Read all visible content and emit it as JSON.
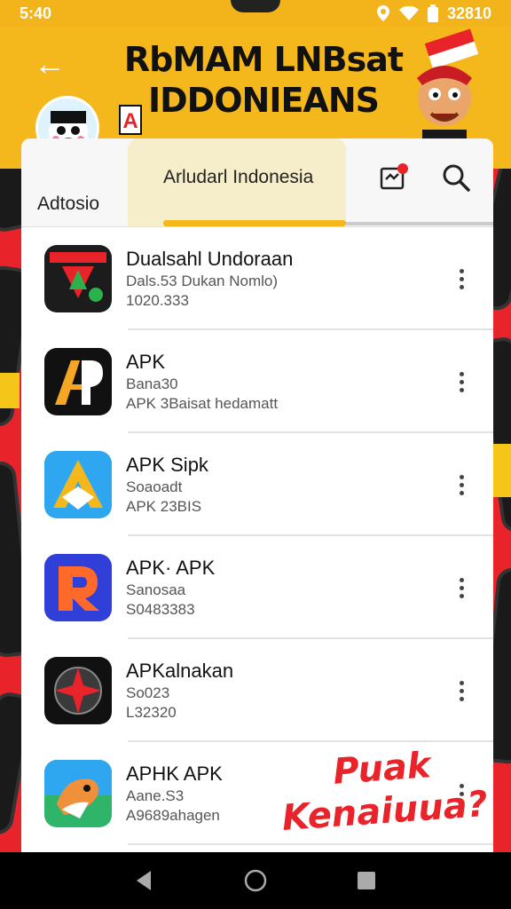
{
  "status_bar": {
    "time": "5:40",
    "battery": "32810"
  },
  "header": {
    "title_line1": "RbMAM LNBsat",
    "title_line2": "IDDONIEANS",
    "badge": "A"
  },
  "tabs": {
    "left_label": "Adtosio",
    "active_label": "Arludarl Indonesia"
  },
  "apps": [
    {
      "name": "Dualsahl Undoraan",
      "line1": "Dals.53 Dukan Nomlo)",
      "line2": "1020.333",
      "icon": "game-app-icon"
    },
    {
      "name": "APK",
      "line1": "Bana30",
      "line2": "APK 3Baisat hedamatt",
      "icon": "ap-logo-icon"
    },
    {
      "name": "APK Sipk",
      "line1": "Soaoadt",
      "line2": "APK 23BIS",
      "icon": "a-arrow-icon"
    },
    {
      "name": "APK· APK",
      "line1": "Sanosaa",
      "line2": "S0483383",
      "icon": "r-logo-icon"
    },
    {
      "name": "APKalnakan",
      "line1": "So023",
      "line2": "L32320",
      "icon": "compass-star-icon"
    },
    {
      "name": "APHK APK",
      "line1": "Aane.S3",
      "line2": "A9689ahagen",
      "icon": "bird-icon"
    }
  ],
  "promo": {
    "line1": "Puak",
    "line2": "Kenaiuua?"
  },
  "colors": {
    "accent": "#f5b81c",
    "brand_red": "#e8232a"
  }
}
